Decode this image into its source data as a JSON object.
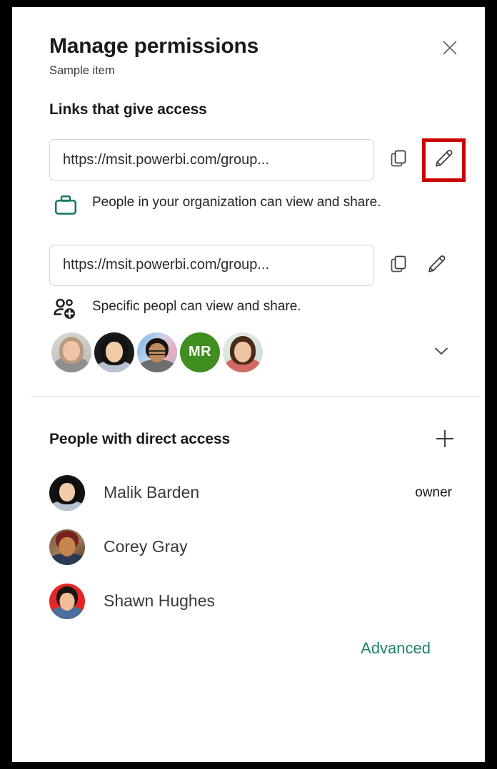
{
  "dialog": {
    "title": "Manage permissions",
    "subtitle": "Sample item",
    "close_icon": "close-icon"
  },
  "links_section": {
    "heading": "Links that give access",
    "links": [
      {
        "url": "https://msit.powerbi.com/group...",
        "copy_icon": "copy-icon",
        "edit_icon": "pencil-icon",
        "edit_highlighted": true,
        "scope_icon": "briefcase-icon",
        "scope_icon_color": "#1a7a63",
        "description": "People in your organization can view and share."
      },
      {
        "url": "https://msit.powerbi.com/group...",
        "copy_icon": "copy-icon",
        "edit_icon": "pencil-icon",
        "edit_highlighted": false,
        "scope_icon": "people-add-icon",
        "scope_icon_color": "#201f1e",
        "description": "Specific peopl can view and share."
      }
    ],
    "avatars": [
      {
        "type": "photo",
        "name": "avatar-person-1"
      },
      {
        "type": "photo",
        "name": "avatar-person-2"
      },
      {
        "type": "photo",
        "name": "avatar-person-3"
      },
      {
        "type": "initials",
        "name": "avatar-person-4",
        "initials": "MR",
        "color": "#3f8e1f"
      },
      {
        "type": "photo",
        "name": "avatar-person-5"
      }
    ],
    "expand_icon": "chevron-down-icon"
  },
  "direct_access": {
    "heading": "People with direct access",
    "add_icon": "plus-icon",
    "people": [
      {
        "name": "Malik Barden",
        "role": "owner"
      },
      {
        "name": "Corey Gray",
        "role": ""
      },
      {
        "name": "Shawn Hughes",
        "role": ""
      }
    ]
  },
  "footer": {
    "advanced_label": "Advanced",
    "advanced_color": "#21836a"
  },
  "highlight": {
    "color": "#cc0101",
    "target": "edit-link-button-1"
  }
}
